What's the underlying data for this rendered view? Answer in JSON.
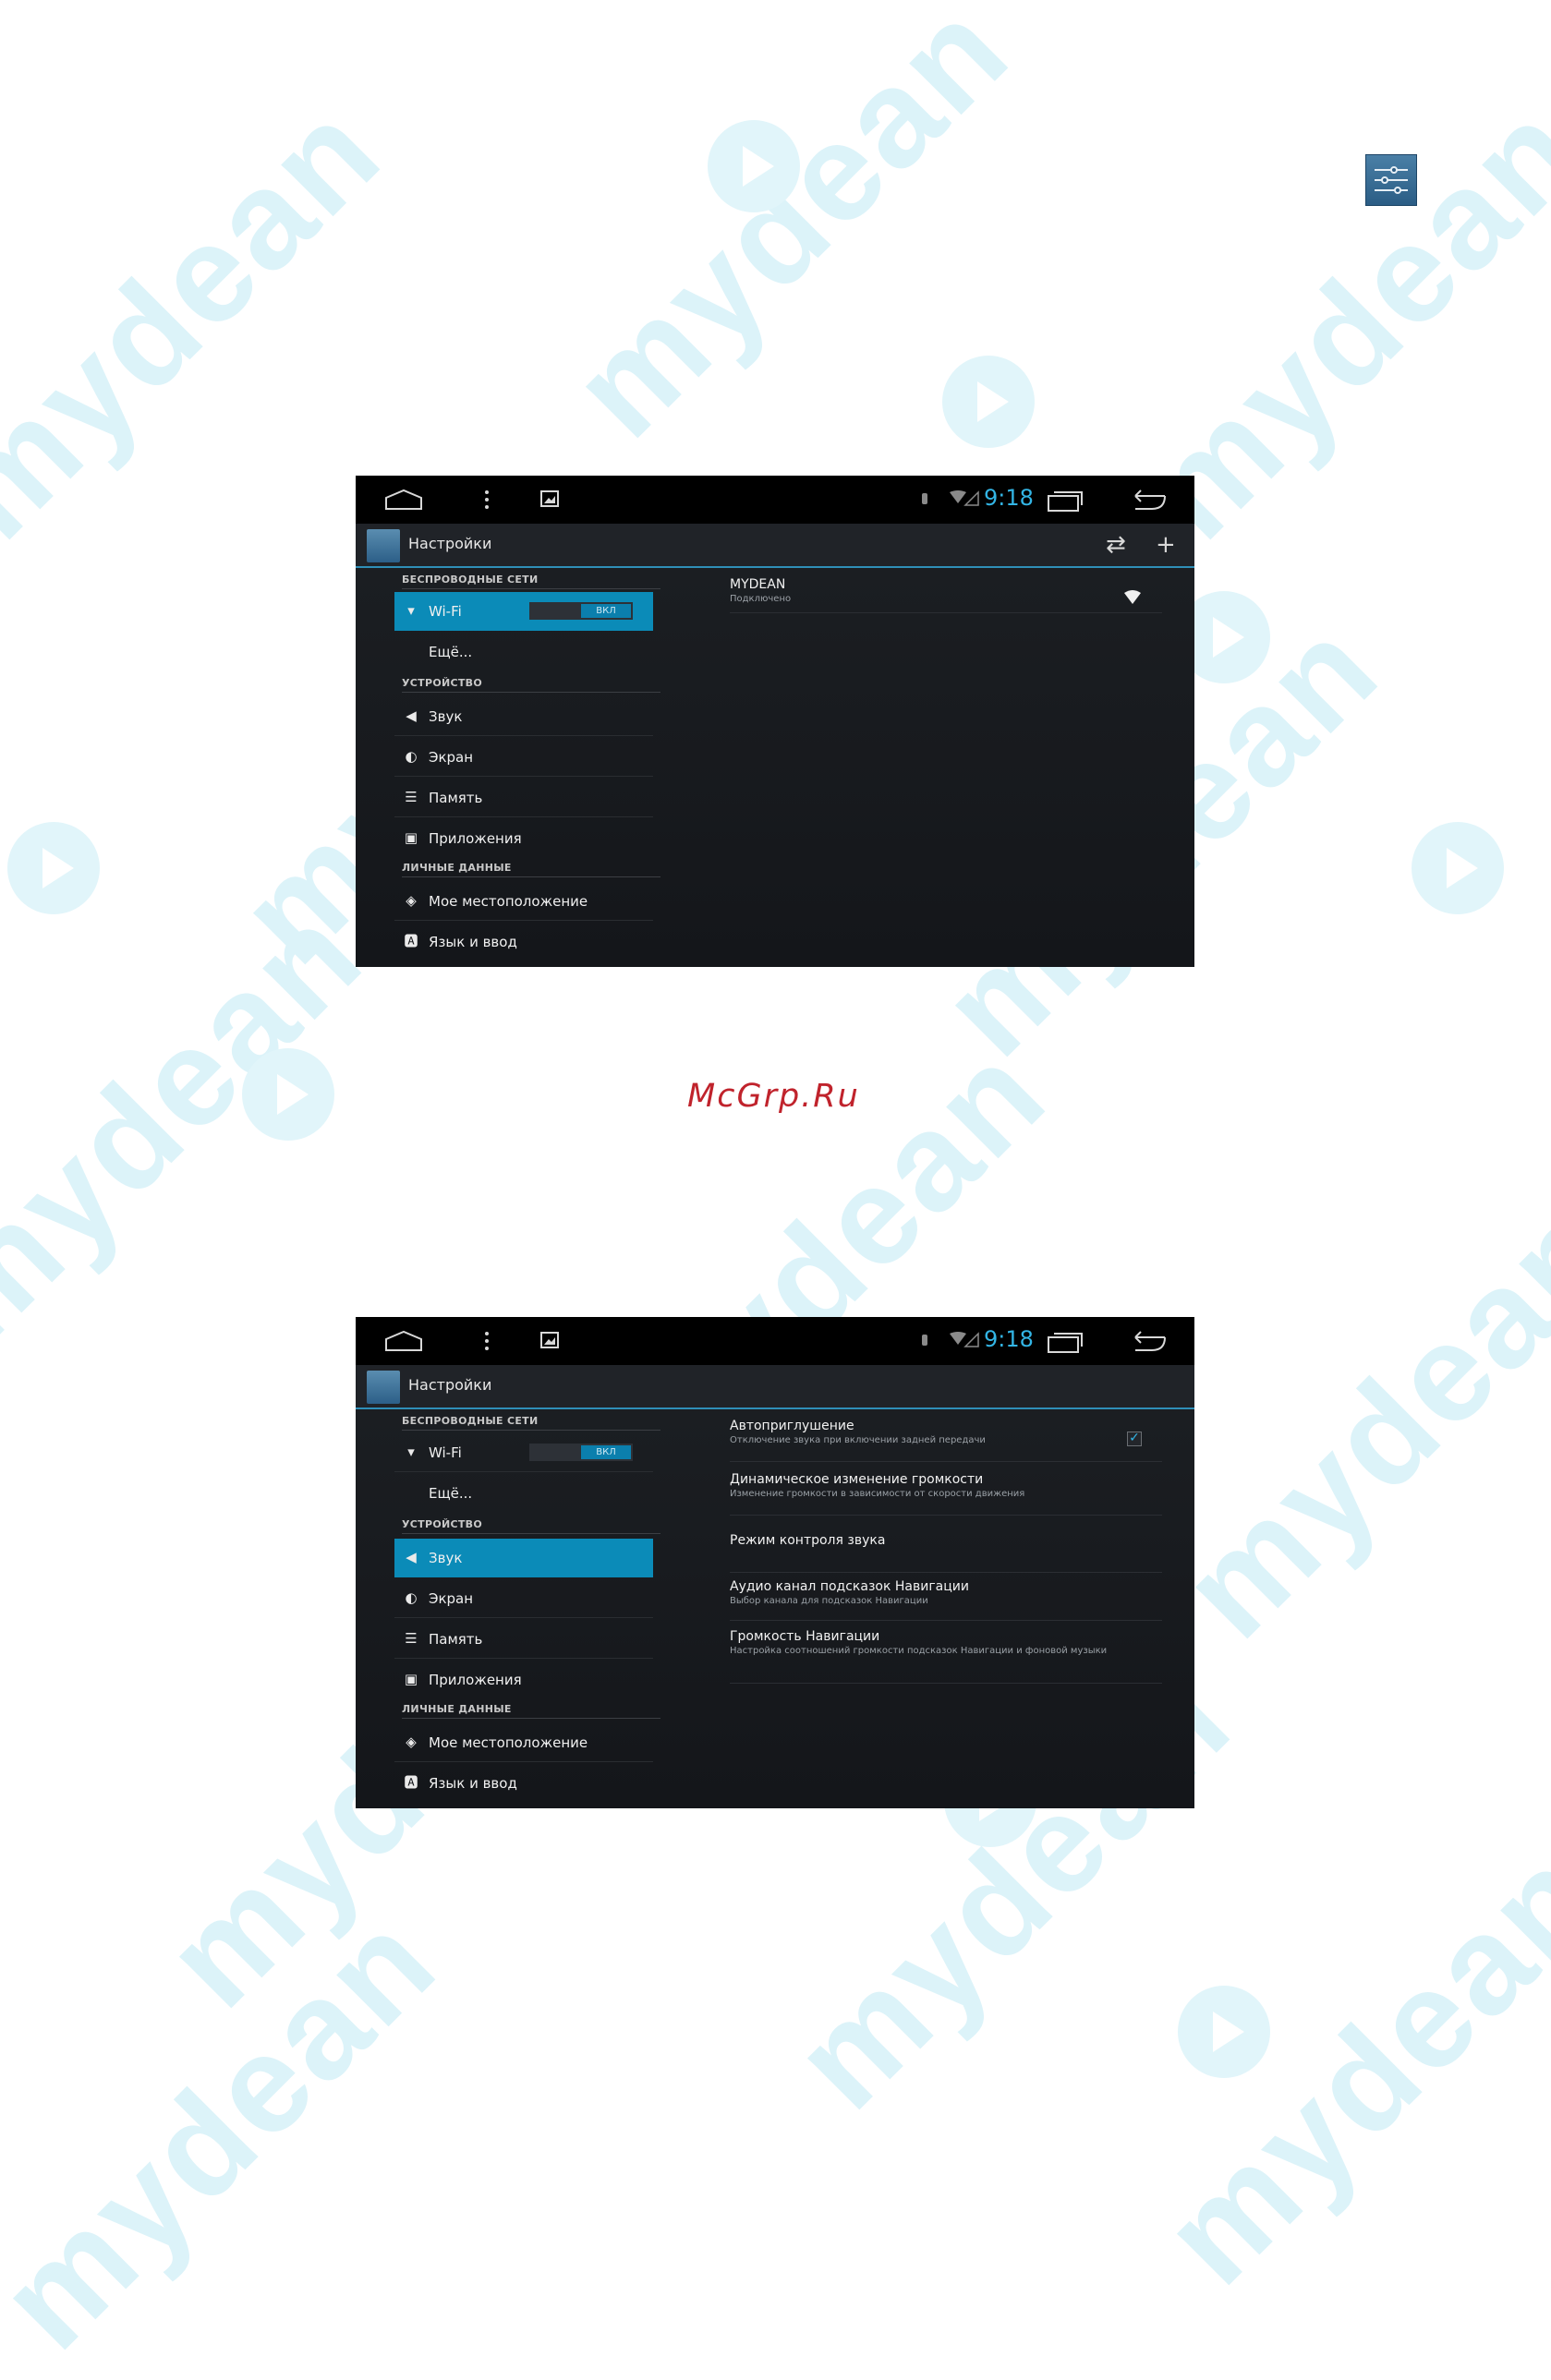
{
  "watermark": {
    "text": "mydean"
  },
  "footer": {
    "site": "McGrp.Ru"
  },
  "colors": {
    "accent": "#33b5e5",
    "selected": "#0b8bb8",
    "watermark": "#dcf3f9"
  },
  "page_icon": "settings-sliders-icon",
  "screens": [
    {
      "status": {
        "time": "9:18"
      },
      "actionbar": {
        "title": "Настройки",
        "actions": [
          "sync-icon",
          "add-icon"
        ]
      },
      "nav": {
        "cat_wireless": "БЕСПРОВОДНЫЕ СЕТИ",
        "wifi": "Wi-Fi",
        "wifi_toggle": "ВКЛ",
        "more": "Ещё...",
        "cat_device": "УСТРОЙСТВО",
        "sound": "Звук",
        "display": "Экран",
        "storage": "Память",
        "apps": "Приложения",
        "cat_personal": "ЛИЧНЫЕ ДАННЫЕ",
        "location": "Мое местоположение",
        "language": "Язык и ввод"
      },
      "selected": "Wi-Fi",
      "network": {
        "name": "MYDEAN",
        "status": "Подключено"
      }
    },
    {
      "status": {
        "time": "9:18"
      },
      "actionbar": {
        "title": "Настройки"
      },
      "nav": {
        "cat_wireless": "БЕСПРОВОДНЫЕ СЕТИ",
        "wifi": "Wi-Fi",
        "wifi_toggle": "ВКЛ",
        "more": "Ещё...",
        "cat_device": "УСТРОЙСТВО",
        "sound": "Звук",
        "display": "Экран",
        "storage": "Память",
        "apps": "Приложения",
        "cat_personal": "ЛИЧНЫЕ ДАННЫЕ",
        "location": "Мое местоположение",
        "language": "Язык и ввод"
      },
      "selected": "Звук",
      "prefs": [
        {
          "title": "Автоприглушение",
          "summary": "Отключение звука при включении задней передачи",
          "checked": true
        },
        {
          "title": "Динамическое изменение громкости",
          "summary": "Изменение громкости в зависимости от скорости движения"
        },
        {
          "title": "Режим контроля звука",
          "summary": ""
        },
        {
          "title": "Аудио канал подсказок Навигации",
          "summary": "Выбор канала для подсказок Навигации"
        },
        {
          "title": "Громкость Навигации",
          "summary": "Настройка соотношений громкости подсказок Навигации и фоновой музыки"
        }
      ]
    }
  ]
}
